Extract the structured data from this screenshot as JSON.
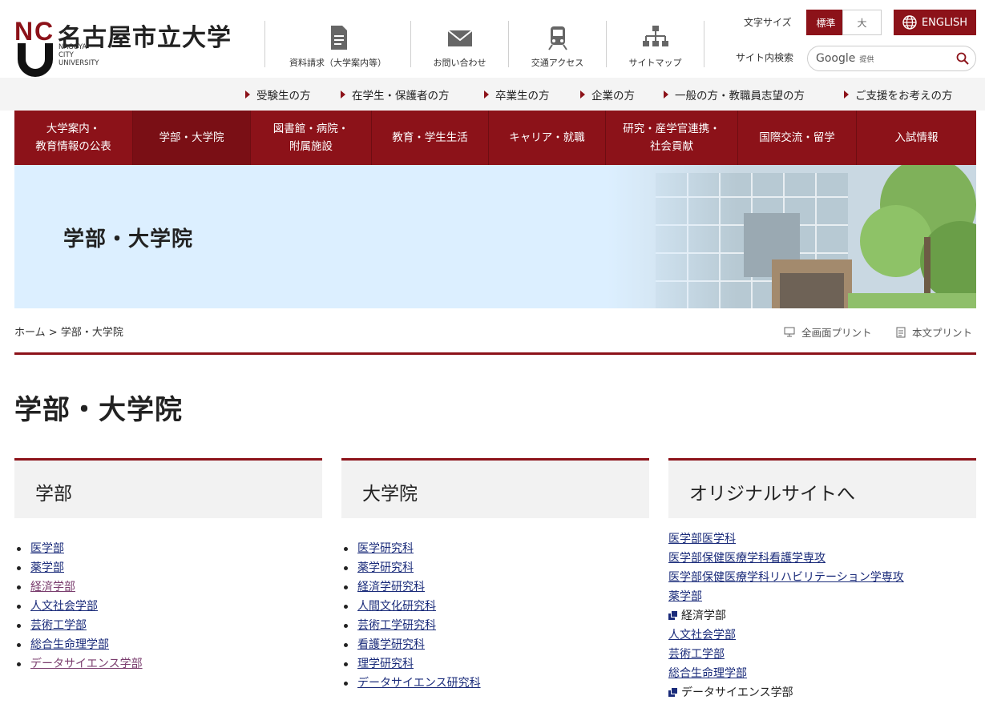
{
  "header": {
    "logo_mark": "NCU",
    "logo_ja": "名古屋市立大学",
    "logo_en_lines": [
      "NAGOYA",
      "CITY",
      "UNIVERSITY"
    ],
    "utility_links": [
      {
        "label": "資料請求（大学案内等）",
        "icon": "document-icon"
      },
      {
        "label": "お問い合わせ",
        "icon": "mail-icon"
      },
      {
        "label": "交通アクセス",
        "icon": "train-icon"
      },
      {
        "label": "サイトマップ",
        "icon": "sitemap-icon"
      }
    ],
    "font_size_label": "文字サイズ",
    "font_size_standard": "標準",
    "font_size_large": "大",
    "english_label": "ENGLISH",
    "search_label": "サイト内検索",
    "search_brand": "Google",
    "search_brand_suffix": "提供",
    "search_placeholder": ""
  },
  "audience_links": [
    "受験生の方",
    "在学生・保護者の方",
    "卒業生の方",
    "企業の方",
    "一般の方・教職員志望の方",
    "ご支援をお考えの方"
  ],
  "global_nav": [
    {
      "label": "大学案内・\n教育情報の公表",
      "active": false
    },
    {
      "label": "学部・大学院",
      "active": true
    },
    {
      "label": "図書館・病院・\n附属施設",
      "active": false
    },
    {
      "label": "教育・学生生活",
      "active": false
    },
    {
      "label": "キャリア・就職",
      "active": false
    },
    {
      "label": "研究・産学官連携・\n社会貢献",
      "active": false
    },
    {
      "label": "国際交流・留学",
      "active": false
    },
    {
      "label": "入試情報",
      "active": false
    }
  ],
  "hero": {
    "title": "学部・大学院"
  },
  "breadcrumb": {
    "home": "ホーム",
    "separator": ">",
    "current": "学部・大学院"
  },
  "print": {
    "full": "全画面プリント",
    "body": "本文プリント"
  },
  "page_title": "学部・大学院",
  "columns": {
    "faculties": {
      "title": "学部",
      "items": [
        "医学部",
        "薬学部",
        "経済学部",
        "人文社会学部",
        "芸術工学部",
        "総合生命理学部",
        "データサイエンス学部"
      ]
    },
    "graduate": {
      "title": "大学院",
      "items": [
        "医学研究科",
        "薬学研究科",
        "経済学研究科",
        "人間文化研究科",
        "芸術工学研究科",
        "看護学研究科",
        "理学研究科",
        "データサイエンス研究科"
      ]
    },
    "original_sites": {
      "title": "オリジナルサイトへ",
      "items": [
        {
          "label": "医学部医学科",
          "external": false
        },
        {
          "label": "医学部保健医療学科看護学専攻",
          "external": false
        },
        {
          "label": "医学部保健医療学科リハビリテーション学専攻",
          "external": false
        },
        {
          "label": "薬学部",
          "external": false
        },
        {
          "label": "経済学部",
          "external": true
        },
        {
          "label": "人文社会学部",
          "external": false
        },
        {
          "label": "芸術工学部",
          "external": false
        },
        {
          "label": "総合生命理学部",
          "external": false
        },
        {
          "label": "データサイエンス学部",
          "external": true
        }
      ]
    }
  },
  "colors": {
    "brand": "#8c1219",
    "link": "#1a2b7a",
    "hero_bg": "#dcefff"
  }
}
